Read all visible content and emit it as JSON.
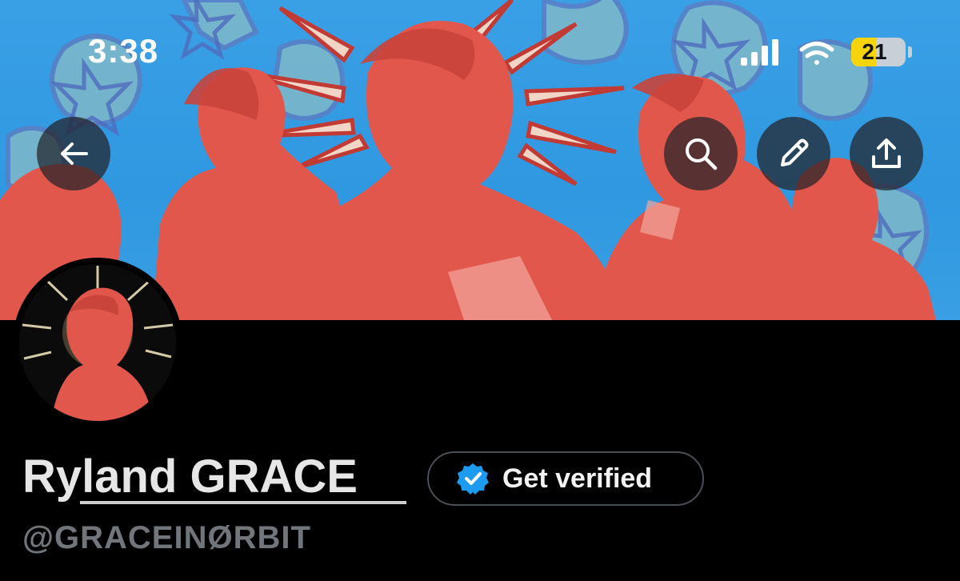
{
  "status_bar": {
    "time": "3:38",
    "battery_level": "21",
    "battery_fraction": 0.21,
    "icons": [
      "cellular-signal-icon",
      "wifi-icon",
      "battery-icon"
    ]
  },
  "header": {
    "buttons": [
      "back-arrow-icon",
      "search-icon",
      "pencil-icon",
      "share-icon"
    ]
  },
  "profile": {
    "display_name": "Ryland GRACE",
    "handle": "@GRACEINØRBIT",
    "verify_button_label": "Get verified",
    "verify_badge_icon": "verified-badge-icon"
  },
  "colors": {
    "background": "#000000",
    "banner_sky": "#3aa0e6",
    "banner_red": "#e2574c",
    "handle_gray": "#71767b",
    "verified_blue": "#1d9bf0",
    "battery_yellow": "#f6d40b"
  }
}
